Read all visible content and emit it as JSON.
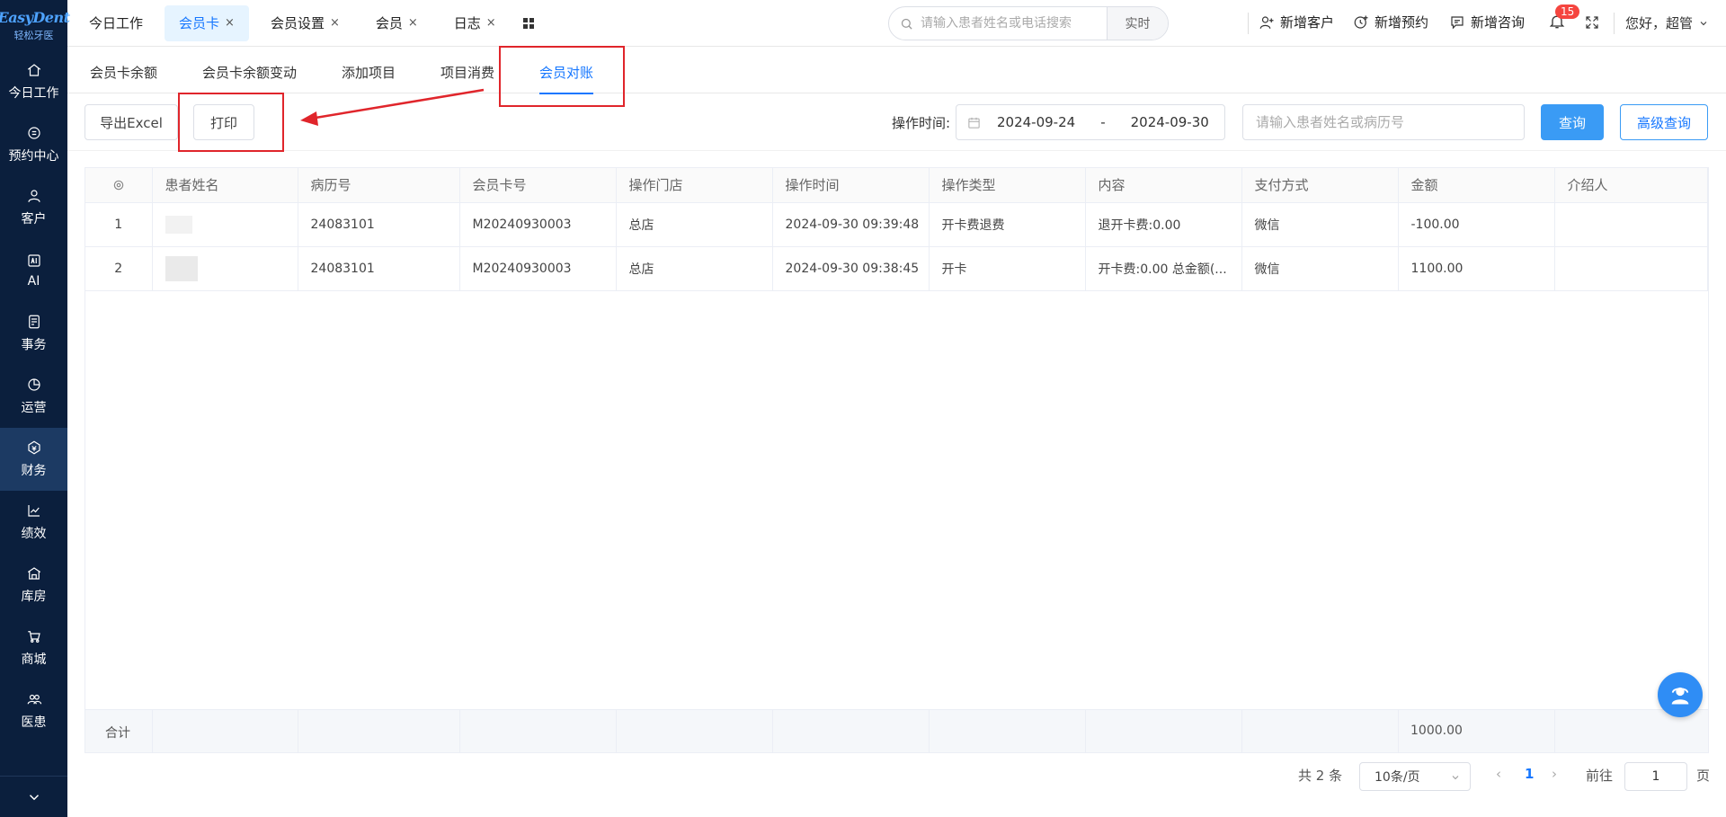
{
  "sidebar": {
    "brand": "EasyDent",
    "brand_sub": "轻松牙医",
    "items": [
      {
        "label": "今日工作",
        "icon": "home-icon"
      },
      {
        "label": "预约中心",
        "icon": "appointment-icon"
      },
      {
        "label": "客户",
        "icon": "user-icon"
      },
      {
        "label": "AI",
        "icon": "ai-icon"
      },
      {
        "label": "事务",
        "icon": "task-icon"
      },
      {
        "label": "运营",
        "icon": "pie-icon"
      },
      {
        "label": "财务",
        "icon": "finance-icon",
        "active": true
      },
      {
        "label": "绩效",
        "icon": "chart-icon"
      },
      {
        "label": "库房",
        "icon": "warehouse-icon"
      },
      {
        "label": "商城",
        "icon": "cart-icon"
      },
      {
        "label": "医患",
        "icon": "people-icon"
      }
    ]
  },
  "topbar": {
    "tabs": [
      {
        "label": "今日工作",
        "closable": false
      },
      {
        "label": "会员卡",
        "closable": true,
        "active": true
      },
      {
        "label": "会员设置",
        "closable": true
      },
      {
        "label": "会员",
        "closable": true
      },
      {
        "label": "日志",
        "closable": true
      }
    ],
    "close_glyph": "×",
    "search_placeholder": "请输入患者姓名或电话搜索",
    "search_mode": "实时",
    "add_customer": "新增客户",
    "add_appointment": "新增预约",
    "add_consult": "新增咨询",
    "notification_count": "15",
    "greeting": "您好，超管"
  },
  "subtabs": [
    {
      "label": "会员卡余额"
    },
    {
      "label": "会员卡余额变动"
    },
    {
      "label": "添加项目"
    },
    {
      "label": "项目消费"
    },
    {
      "label": "会员对账",
      "active": true
    }
  ],
  "toolbar": {
    "export_label": "导出Excel",
    "print_label": "打印",
    "time_label": "操作时间:",
    "date_start": "2024-09-24",
    "date_sep": "-",
    "date_end": "2024-09-30",
    "query_placeholder": "请输入患者姓名或病历号",
    "query_label": "查询",
    "advanced_label": "高级查询"
  },
  "table": {
    "columns": [
      "患者姓名",
      "病历号",
      "会员卡号",
      "操作门店",
      "操作时间",
      "操作类型",
      "内容",
      "支付方式",
      "金额",
      "介绍人"
    ],
    "rows": [
      {
        "idx": "1",
        "name": "",
        "record": "24083101",
        "card": "M20240930003",
        "store": "总店",
        "time": "2024-09-30 09:39:48",
        "type": "开卡费退费",
        "content": "退开卡费:0.00",
        "pay": "微信",
        "amount": "-100.00",
        "referrer": ""
      },
      {
        "idx": "2",
        "name": "",
        "record": "24083101",
        "card": "M20240930003",
        "store": "总店",
        "time": "2024-09-30 09:38:45",
        "type": "开卡",
        "content": "开卡费:0.00 总金额(...",
        "pay": "微信",
        "amount": "1100.00",
        "referrer": ""
      }
    ],
    "summary_label": "合计",
    "summary_amount": "1000.00"
  },
  "pagination": {
    "total": "共 2 条",
    "page_size": "10条/页",
    "current": "1",
    "goto_label": "前往",
    "goto_value": "1",
    "page_unit": "页"
  },
  "colors": {
    "sidebar_bg": "#0b1f3d",
    "accent": "#1677ff",
    "primary_btn": "#3a9bf5",
    "annotation": "#e0252b"
  }
}
